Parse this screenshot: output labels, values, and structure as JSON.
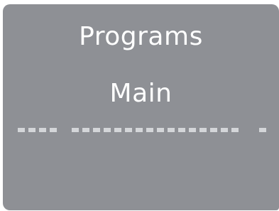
{
  "screen": {
    "title": "Programs",
    "subtitle": "Main"
  },
  "progress": {
    "segments": [
      "short",
      "long",
      "tiny"
    ]
  }
}
